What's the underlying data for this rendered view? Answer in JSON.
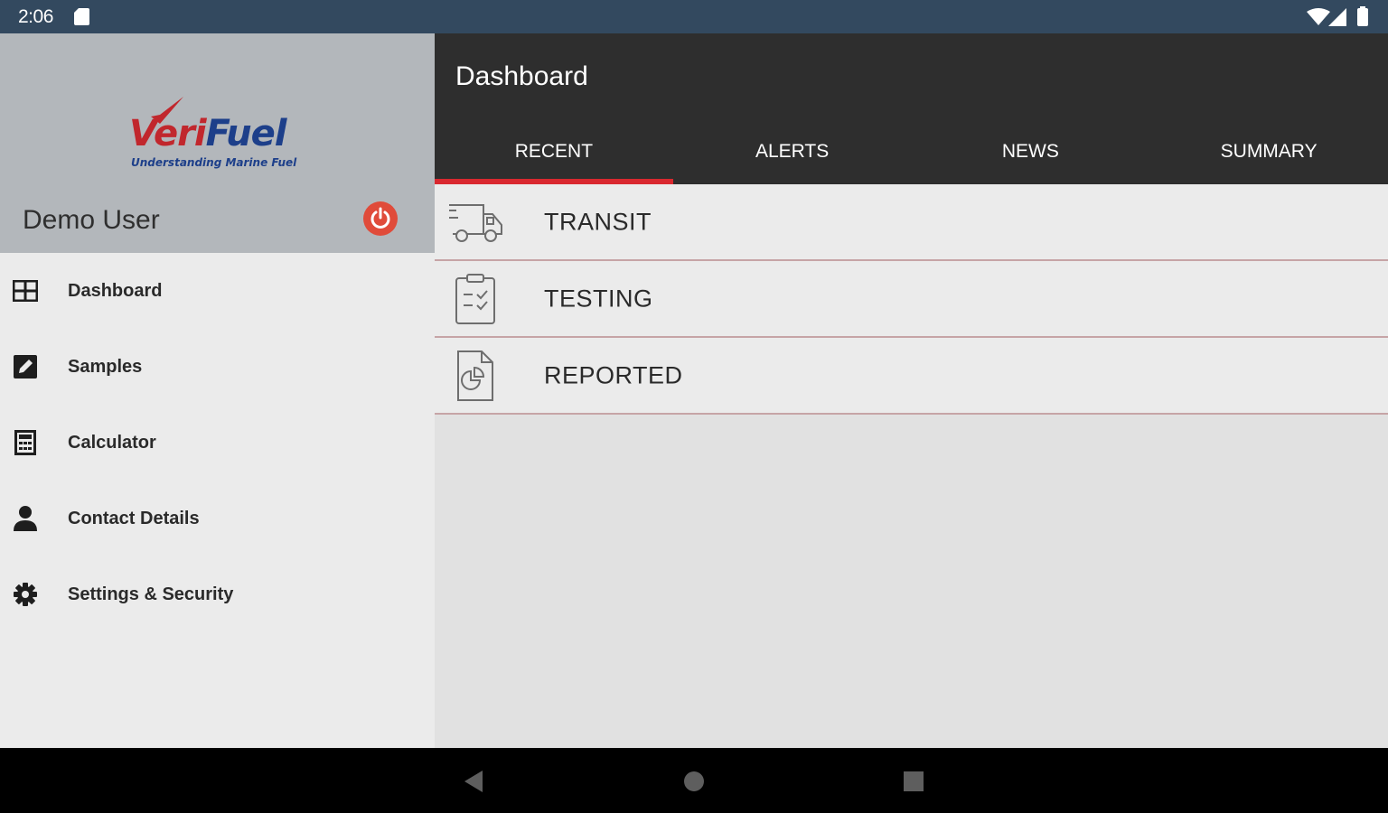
{
  "status_bar": {
    "time": "2:06",
    "sd_icon": "sd-card-icon",
    "wifi_icon": "wifi-icon",
    "signal_icon": "cell-signal-icon",
    "battery_icon": "battery-icon"
  },
  "drawer": {
    "logo": {
      "brand_part1": "Veri",
      "brand_part2": "Fuel",
      "tagline": "Understanding Marine Fuel"
    },
    "user_name": "Demo User",
    "power_icon": "power-icon",
    "items": [
      {
        "label": "Dashboard",
        "icon": "dashboard-icon"
      },
      {
        "label": "Samples",
        "icon": "edit-icon"
      },
      {
        "label": "Calculator",
        "icon": "calculator-icon"
      },
      {
        "label": "Contact Details",
        "icon": "person-icon"
      },
      {
        "label": "Settings & Security",
        "icon": "gear-icon"
      }
    ]
  },
  "app_bar": {
    "title": "Dashboard",
    "tabs": [
      {
        "label": "RECENT",
        "active": true
      },
      {
        "label": "ALERTS",
        "active": false
      },
      {
        "label": "NEWS",
        "active": false
      },
      {
        "label": "SUMMARY",
        "active": false
      }
    ]
  },
  "list": [
    {
      "label": "TRANSIT",
      "icon": "truck-icon"
    },
    {
      "label": "TESTING",
      "icon": "clipboard-check-icon"
    },
    {
      "label": "REPORTED",
      "icon": "report-chart-icon"
    }
  ],
  "colors": {
    "accent_red": "#d9282f",
    "status_bar": "#33495f",
    "app_bar": "#2e2e2e",
    "drawer_header": "#b3b7bb",
    "logo_blue": "#1d3f8a",
    "logo_red": "#c1272d",
    "power_red": "#e04b3a"
  },
  "system_nav": {
    "back_icon": "back-icon",
    "home_icon": "home-icon",
    "recents_icon": "recents-icon"
  }
}
